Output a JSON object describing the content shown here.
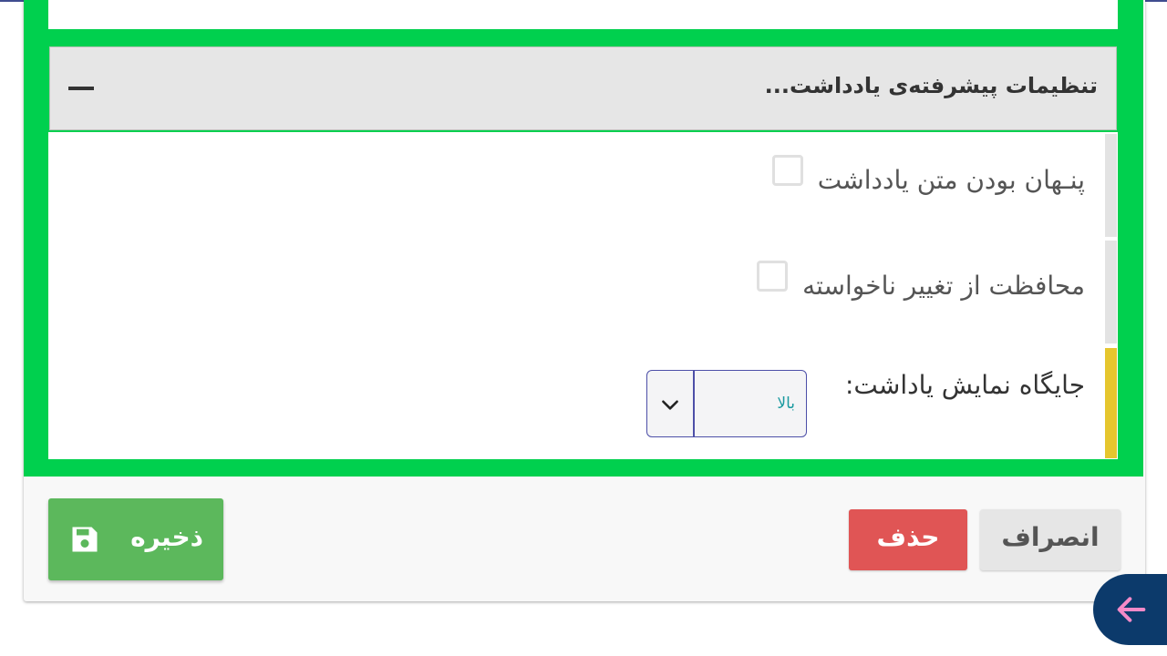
{
  "panel": {
    "title": "تنظیمات پیشرفته‌ی یادداشت...",
    "collapse_icon": "minus-icon"
  },
  "options": {
    "hide_text_label": "پنـهان بودن متن یادداشت",
    "protect_label": "محافظت از تغییر ناخواسته",
    "position_label": "جایگاه نمایش یاداشت:",
    "position_value": "بالا"
  },
  "actions": {
    "save_label": "ذخیره",
    "delete_label": "حذف",
    "cancel_label": "انصراف"
  },
  "colors": {
    "frame": "#00d04e",
    "save": "#5cb85c",
    "delete": "#e05555",
    "cancel": "#e6e6e6",
    "fab": "#0c3a6b",
    "highlight_bar": "#e6c62e"
  }
}
